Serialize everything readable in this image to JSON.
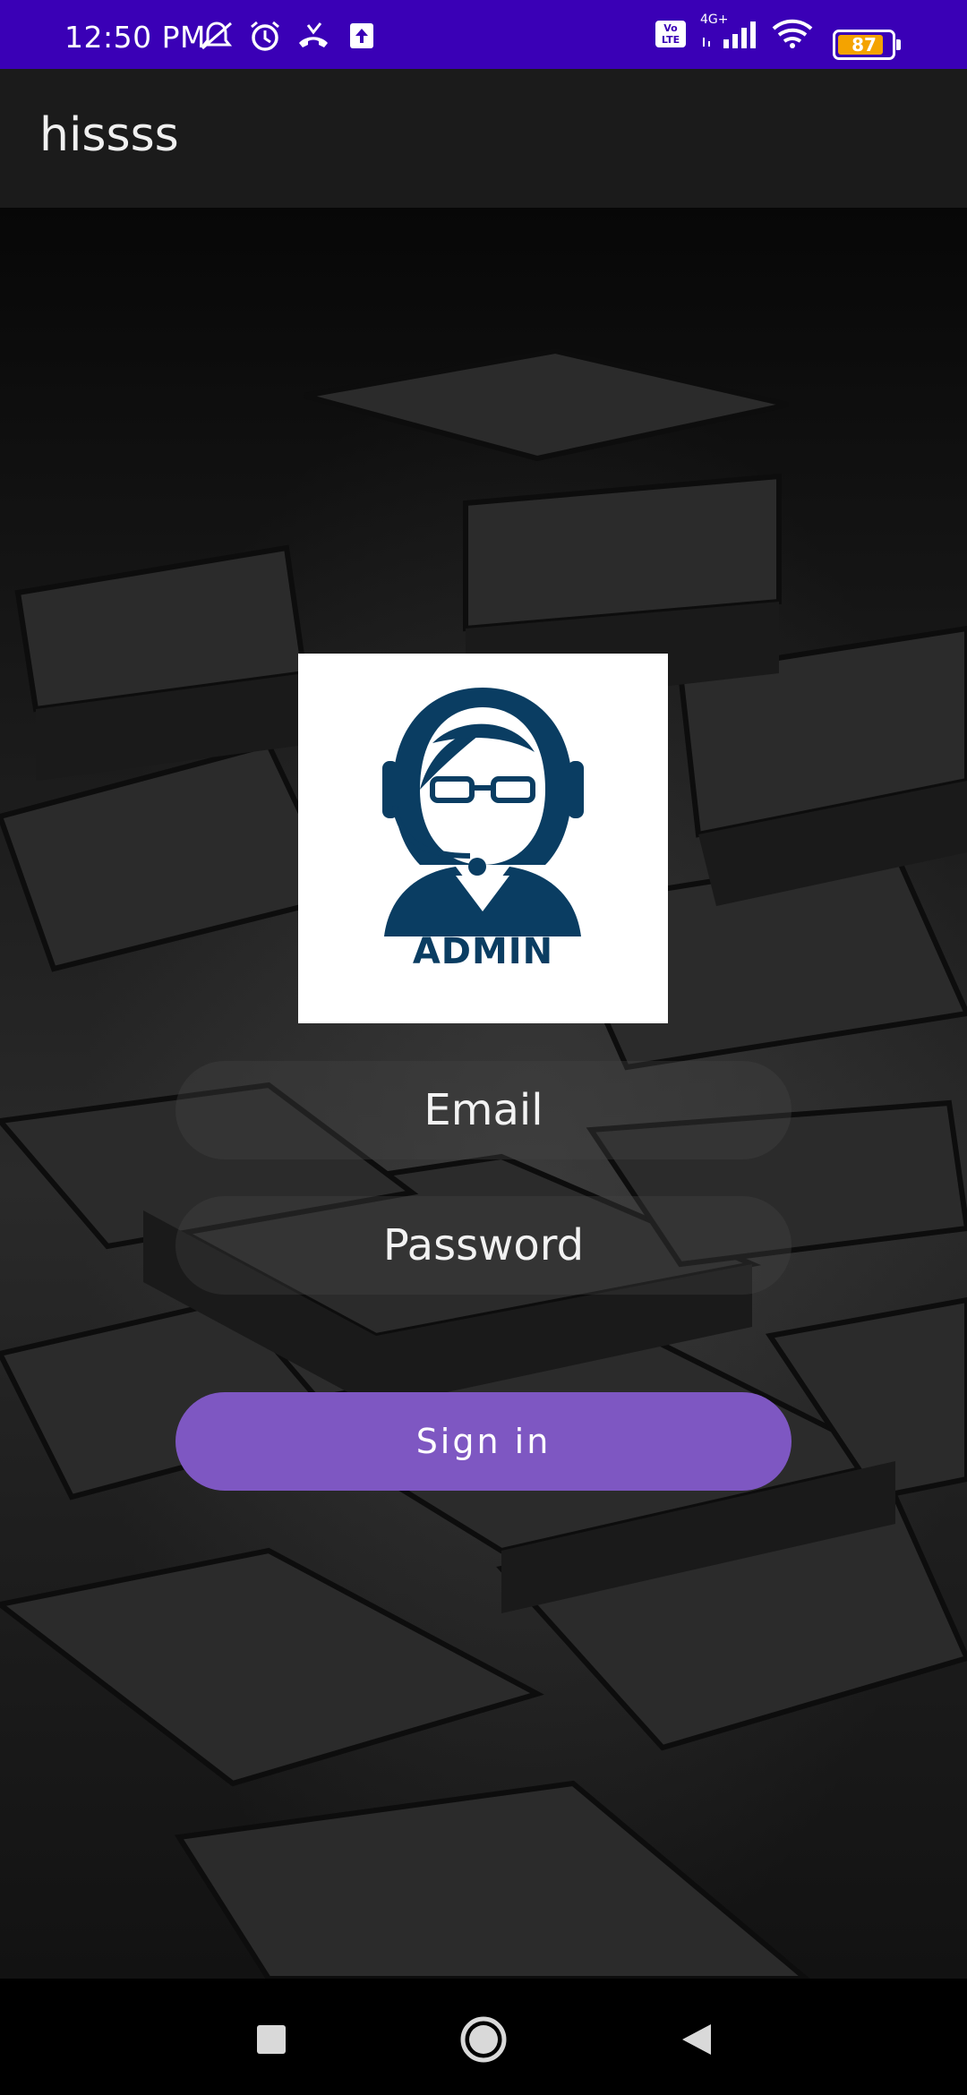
{
  "status_bar": {
    "time": "12:50 PM",
    "battery_level": "87",
    "battery_fraction": 0.87,
    "left_icons": [
      "silent-mode-icon",
      "alarm-icon",
      "call-forward-icon",
      "upload-icon"
    ],
    "right_icons": [
      "volte-icon",
      "signal-4g-icon",
      "wifi-icon",
      "battery-icon"
    ],
    "network_label": "4G+",
    "volte_label": "Vo LTE"
  },
  "app_bar": {
    "title": "hissss"
  },
  "logo": {
    "label": "ADMIN",
    "color": "#0a3d62"
  },
  "form": {
    "email_placeholder": "Email",
    "email_value": "",
    "password_placeholder": "Password",
    "password_value": "",
    "signin_label": "Sign in"
  },
  "nav_bar": {
    "icons": [
      "recents-icon",
      "home-icon",
      "back-icon"
    ]
  },
  "colors": {
    "status_bar": "#3a00b6",
    "app_bar": "#1b1b1b",
    "accent": "#7e57c2",
    "battery": "#f4a300"
  }
}
